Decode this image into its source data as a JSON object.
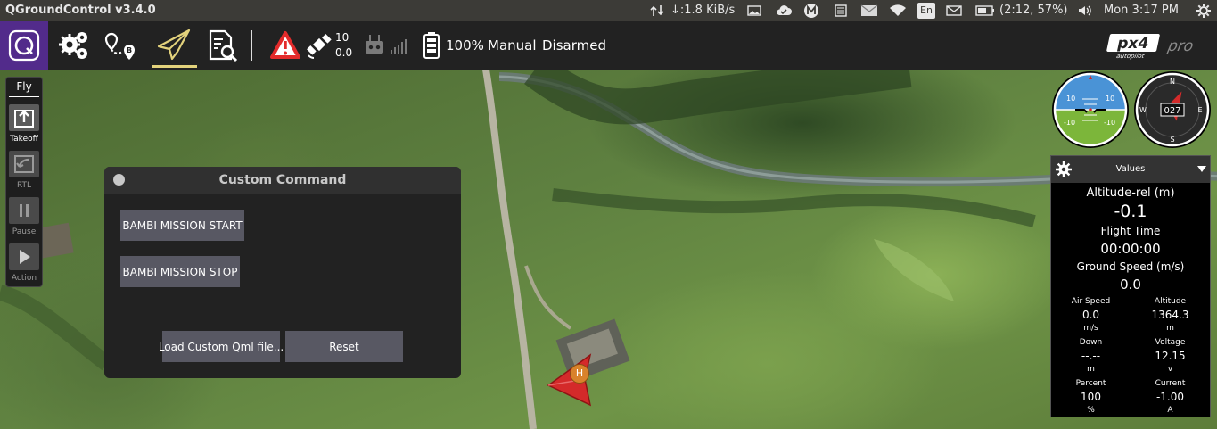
{
  "os_bar": {
    "app_title": "QGroundControl v3.4.0",
    "network_speed": "↓:1.8 KiB/s",
    "keyboard_layout": "En",
    "battery_status": "(2:12, 57%)",
    "clock": "Mon  3:17 PM",
    "icons": [
      "transfer-icon",
      "image-icon",
      "cloud-icon",
      "m-badge-icon",
      "memory-icon",
      "mail-tray-icon",
      "wifi-icon",
      "keyboard-icon",
      "envelope-icon",
      "battery-icon",
      "volume-icon",
      "system-gear-icon"
    ]
  },
  "toolbar": {
    "buttons": [
      "settings-gears-icon",
      "plan-route-icon",
      "fly-paper-plane-icon",
      "analyze-document-icon"
    ],
    "satellite_count": "10",
    "hdop": "0.0",
    "battery_percent": "100%",
    "flight_mode": "Manual",
    "arm_state": "Disarmed",
    "brand_logo": "PX4 pro autopilot",
    "colors": {
      "active_underline": "#e3d27c",
      "logo_bg": "#522b8b",
      "warning": "#e32b2b"
    }
  },
  "fly_strip": {
    "title": "Fly",
    "items": [
      {
        "label": "Takeoff",
        "icon": "takeoff-icon",
        "enabled": true
      },
      {
        "label": "RTL",
        "icon": "rtl-icon",
        "enabled": false
      },
      {
        "label": "Pause",
        "icon": "pause-icon",
        "enabled": false
      },
      {
        "label": "Action",
        "icon": "play-icon",
        "enabled": false
      }
    ]
  },
  "custom_command": {
    "title": "Custom Command",
    "start_label": "BAMBI MISSION START",
    "stop_label": "BAMBI MISSION STOP",
    "load_label": "Load Custom Qml file...",
    "reset_label": "Reset"
  },
  "instruments": {
    "attitude_scale": [
      "10",
      "10",
      "-10",
      "-10"
    ],
    "heading": "027",
    "compass_labels": {
      "n": "N",
      "e": "E",
      "s": "S",
      "w": "W"
    }
  },
  "values_panel": {
    "title": "Values",
    "altitude_rel_label": "Altitude-rel (m)",
    "altitude_rel_value": "-0.1",
    "flight_time_label": "Flight Time",
    "flight_time_value": "00:00:00",
    "ground_speed_label": "Ground Speed (m/s)",
    "ground_speed_value": "0.0",
    "grid": [
      {
        "label": "Air Speed",
        "value": "0.0",
        "unit": "m/s"
      },
      {
        "label": "Altitude",
        "value": "1364.3",
        "unit": "m"
      },
      {
        "label": "Down",
        "value": "--.--",
        "unit": "m"
      },
      {
        "label": "Voltage",
        "value": "12.15",
        "unit": "v"
      },
      {
        "label": "Percent",
        "value": "100",
        "unit": "%"
      },
      {
        "label": "Current",
        "value": "-1.00",
        "unit": "A"
      }
    ]
  },
  "map": {
    "home_marker_label": "H",
    "vehicle_color": "#d42a2a"
  }
}
